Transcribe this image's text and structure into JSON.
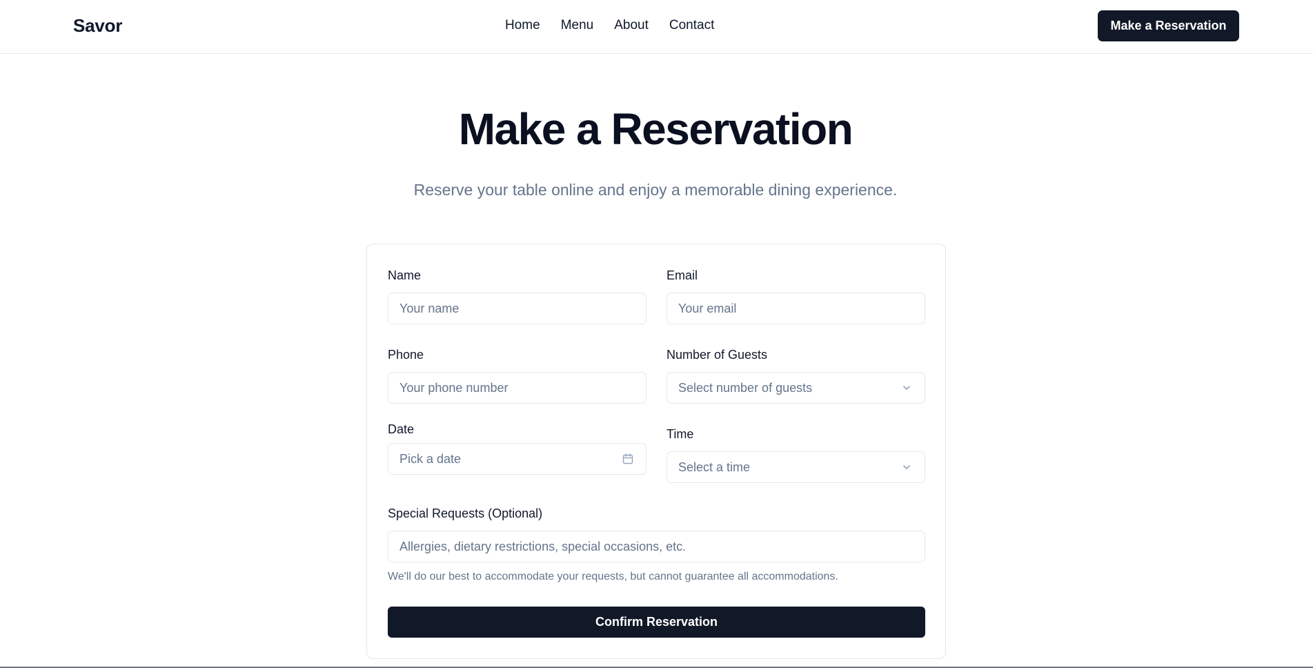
{
  "header": {
    "brand": "Savor",
    "nav": [
      "Home",
      "Menu",
      "About",
      "Contact"
    ],
    "cta_label": "Make a Reservation"
  },
  "hero": {
    "title": "Make a Reservation",
    "subtitle": "Reserve your table online and enjoy a memorable dining experience."
  },
  "form": {
    "name": {
      "label": "Name",
      "value": "",
      "placeholder": "Your name"
    },
    "email": {
      "label": "Email",
      "value": "",
      "placeholder": "Your email"
    },
    "phone": {
      "label": "Phone",
      "value": "",
      "placeholder": "Your phone number"
    },
    "guests": {
      "label": "Number of Guests",
      "selected": "Select number of guests",
      "icon": "chevron-down-icon"
    },
    "date": {
      "label": "Date",
      "selected": "Pick a date",
      "icon": "calendar-icon"
    },
    "time": {
      "label": "Time",
      "selected": "Select a time",
      "icon": "chevron-down-icon"
    },
    "requests": {
      "label": "Special Requests (Optional)",
      "value": "",
      "placeholder": "Allergies, dietary restrictions, special occasions, etc."
    },
    "helper": "We'll do our best to accommodate your requests, but cannot guarantee all accommodations.",
    "submit_label": "Confirm Reservation"
  },
  "colors": {
    "primary": "#111827",
    "muted_text": "#64748b",
    "border": "#e2e8f0"
  }
}
